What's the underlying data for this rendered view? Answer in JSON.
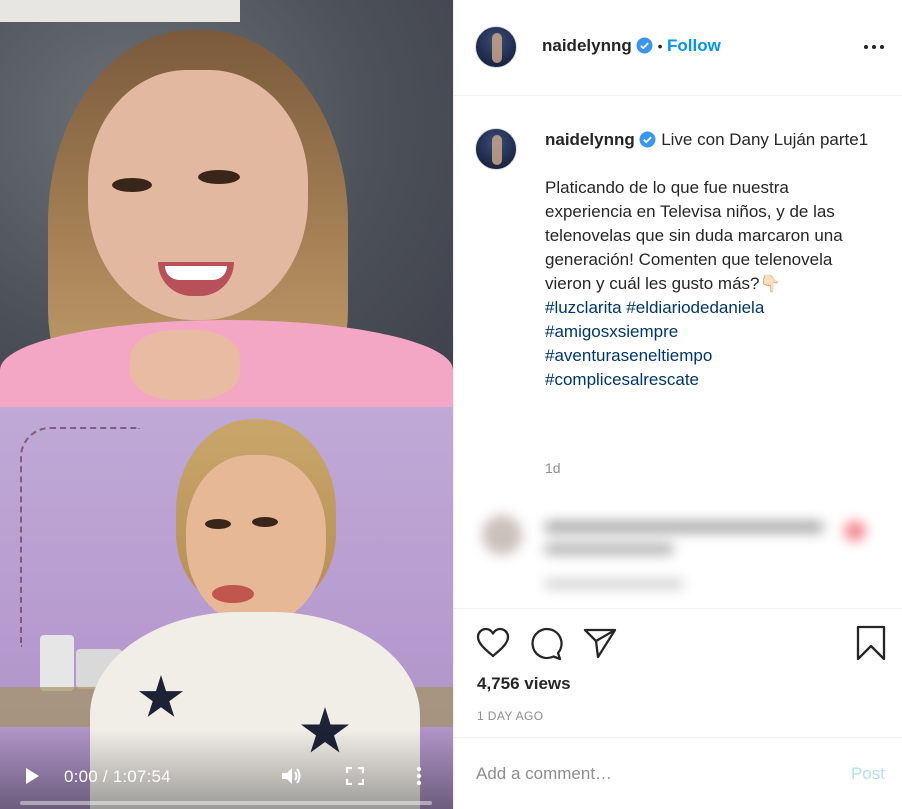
{
  "video": {
    "current_time": "0:00",
    "duration": "1:07:54",
    "progress_fraction": 0
  },
  "header": {
    "username": "naidelynng",
    "separator": "•",
    "follow_label": "Follow"
  },
  "caption": {
    "username": "naidelynng",
    "title": "Live con Dany Luján parte1",
    "body": "Platicando de lo que fue nuestra experiencia en Televisa niños, y de las telenovelas que sin duda marcaron una generación! Comenten que telenovela vieron y cuál les gusto más?👇🏻",
    "hashtags": [
      "#luzclarita",
      "#eldiariodedaniela",
      "#amigosxsiempre",
      "#aventuraseneltiempo",
      "#complicesalrescate"
    ],
    "age": "1d"
  },
  "stats": {
    "views": "4,756 views",
    "posted": "1 DAY AGO"
  },
  "comment": {
    "placeholder": "Add a comment…",
    "post_label": "Post"
  },
  "colors": {
    "accent": "#0095f6",
    "hashtag": "#00376b",
    "muted": "#8e8e8e",
    "post_disabled": "#b2dffc"
  },
  "icons": [
    "play-icon",
    "volume-icon",
    "fullscreen-icon",
    "more-vertical-icon",
    "verified-icon",
    "more-horizontal-icon",
    "heart-icon",
    "comment-icon",
    "share-icon",
    "bookmark-icon"
  ]
}
